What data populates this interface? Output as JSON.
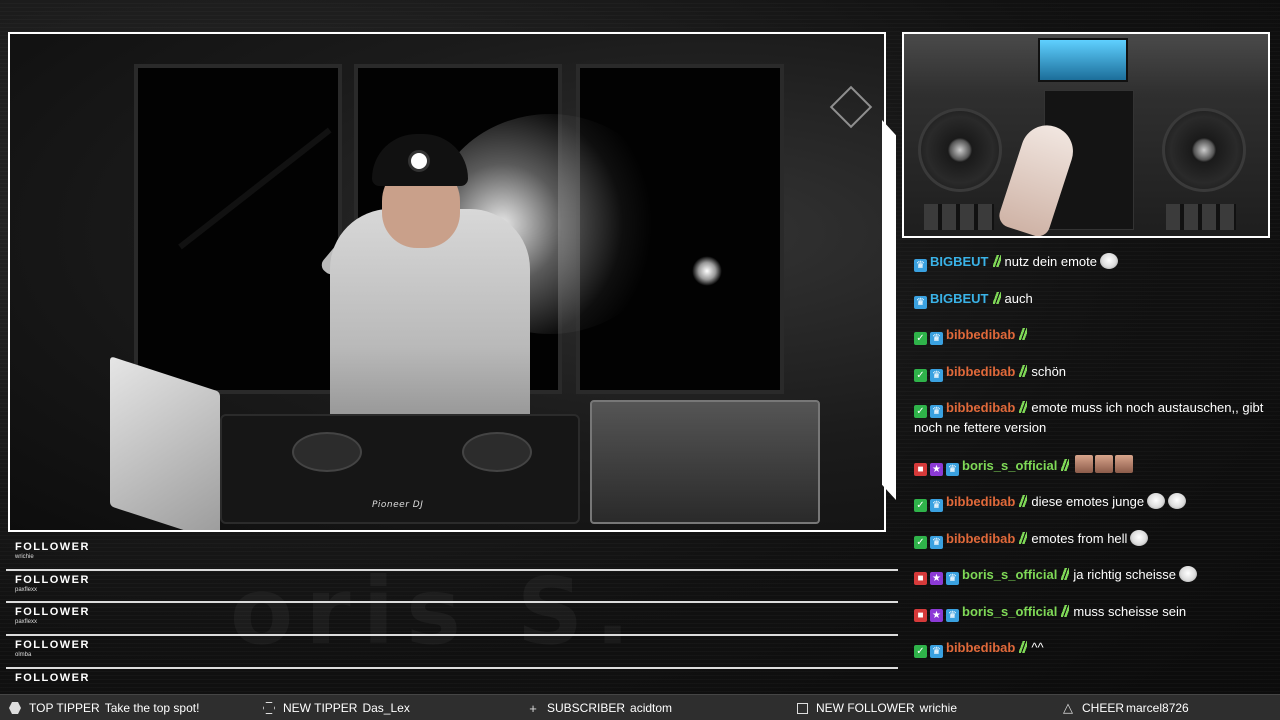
{
  "chat": [
    {
      "badges": [
        "crown"
      ],
      "user": "BIGBEUT",
      "user_color": "#3ab3e8",
      "text": "nutz dein emote",
      "emotes": [
        "emote"
      ]
    },
    {
      "badges": [
        "crown"
      ],
      "user": "BIGBEUT",
      "user_color": "#3ab3e8",
      "text": "auch",
      "emotes": []
    },
    {
      "badges": [
        "check",
        "crown"
      ],
      "user": "bibbedibab",
      "user_color": "#e0693a",
      "text": "",
      "emotes": [
        "tiny-text"
      ]
    },
    {
      "badges": [
        "check",
        "crown"
      ],
      "user": "bibbedibab",
      "user_color": "#e0693a",
      "text": "schön",
      "emotes": []
    },
    {
      "badges": [
        "check",
        "crown"
      ],
      "user": "bibbedibab",
      "user_color": "#e0693a",
      "text": "emote muss ich noch austauschen,, gibt noch ne fettere version",
      "emotes": []
    },
    {
      "badges": [
        "cam",
        "star",
        "crown"
      ],
      "user": "boris_s_official",
      "user_color": "#7fd957",
      "text": "",
      "emotes": [
        "face",
        "face",
        "face"
      ]
    },
    {
      "badges": [
        "check",
        "crown"
      ],
      "user": "bibbedibab",
      "user_color": "#e0693a",
      "text": "diese emotes junge",
      "emotes": [
        "emote",
        "emote"
      ]
    },
    {
      "badges": [
        "check",
        "crown"
      ],
      "user": "bibbedibab",
      "user_color": "#e0693a",
      "text": "emotes from hell",
      "emotes": [
        "emote"
      ]
    },
    {
      "badges": [
        "cam",
        "star",
        "crown"
      ],
      "user": "boris_s_official",
      "user_color": "#7fd957",
      "text": "ja richtig scheisse",
      "emotes": [
        "emote"
      ]
    },
    {
      "badges": [
        "cam",
        "star",
        "crown"
      ],
      "user": "boris_s_official",
      "user_color": "#7fd957",
      "text": "muss scheisse sein",
      "emotes": []
    },
    {
      "badges": [
        "check",
        "crown"
      ],
      "user": "bibbedibab",
      "user_color": "#e0693a",
      "text": "^^",
      "emotes": []
    }
  ],
  "events": [
    {
      "title": "FOLLOWER",
      "name": "wrichie"
    },
    {
      "title": "FOLLOWER",
      "name": "paxflexx"
    },
    {
      "title": "FOLLOWER",
      "name": "paxflexx"
    },
    {
      "title": "FOLLOWER",
      "name": "olmba"
    },
    {
      "title": "FOLLOWER",
      "name": ""
    }
  ],
  "watermark": "oris S.",
  "controller_brand": "Pioneer DJ",
  "ticker": {
    "top_tipper": {
      "label": "TOP TIPPER",
      "value": "Take the top spot!"
    },
    "new_tipper": {
      "label": "NEW TIPPER",
      "value": "Das_Lex"
    },
    "subscriber": {
      "label": "SUBSCRIBER",
      "value": "acidtom"
    },
    "new_follower": {
      "label": "NEW FOLLOWER",
      "value": "wrichie"
    },
    "cheer": {
      "label": "CHEER",
      "value": "marcel8726"
    }
  }
}
